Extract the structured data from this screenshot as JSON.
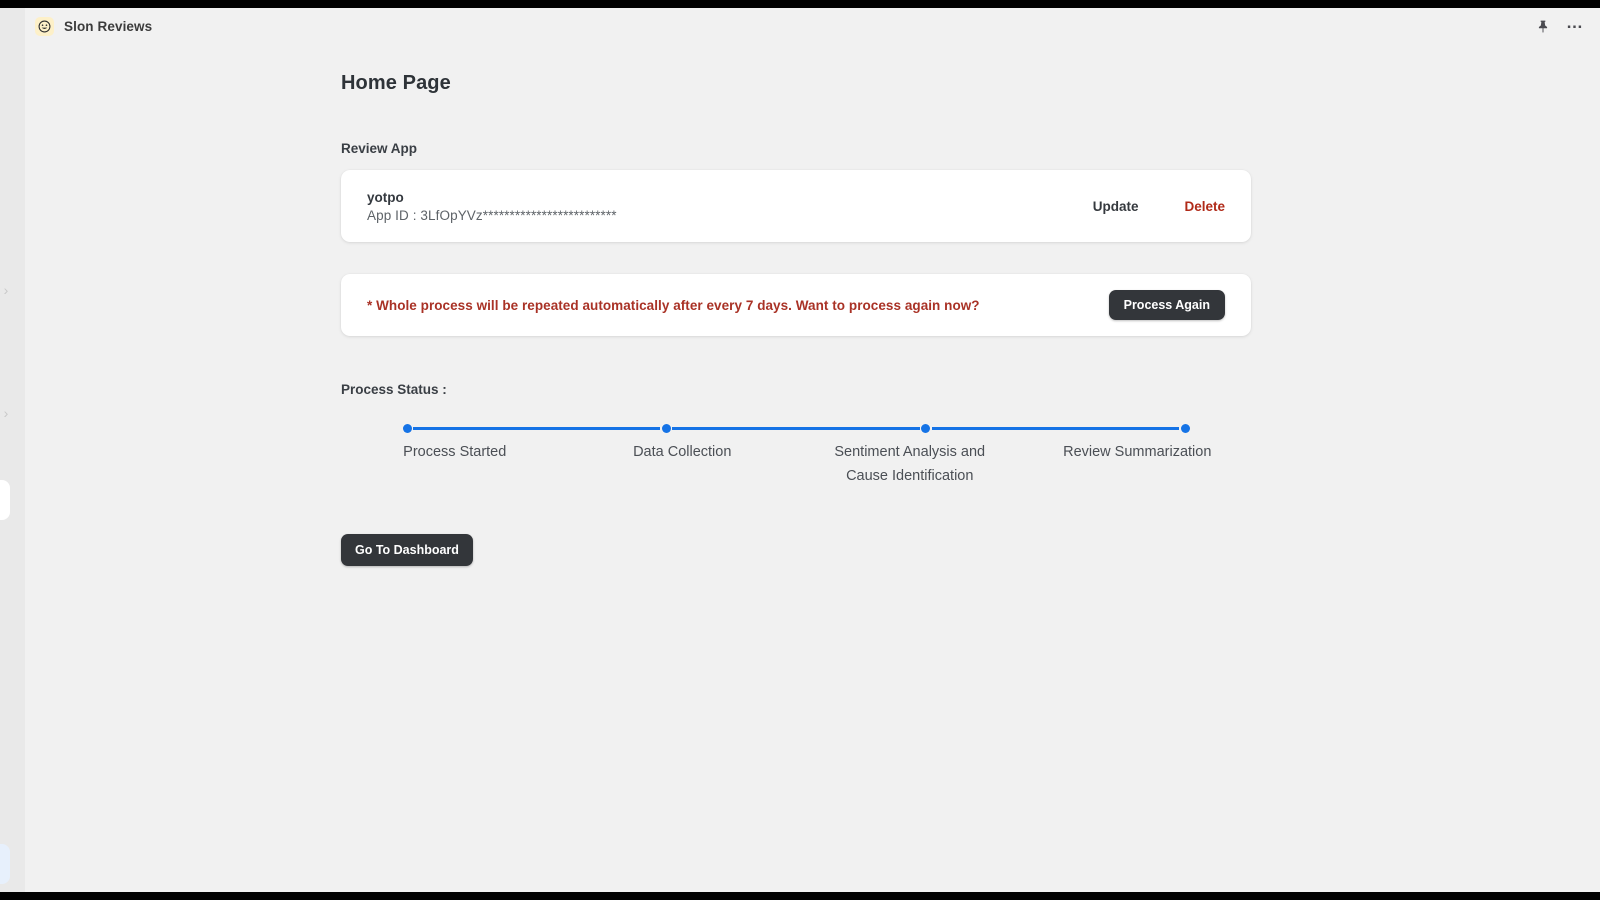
{
  "window": {
    "brand_title": "Slon Reviews",
    "brand_icon": "smiley-face-icon",
    "pin_icon": "pin-icon",
    "more_icon": "…"
  },
  "rail": {
    "chevron_icon": "›"
  },
  "page": {
    "title": "Home Page"
  },
  "review_app": {
    "section_label": "Review App",
    "app_name": "yotpo",
    "app_id": "App ID : 3LfOpYVz*************************",
    "update_label": "Update",
    "delete_label": "Delete",
    "delete_color": "#b02a18"
  },
  "notice": {
    "message": "* Whole process will be repeated automatically after every 7 days. Want to process again now?",
    "message_color": "#a93226",
    "process_again_label": "Process Again"
  },
  "process_status": {
    "section_label": "Process Status :",
    "accent_color": "#1573e6",
    "steps": [
      {
        "label": "Process Started",
        "complete": true
      },
      {
        "label": "Data Collection",
        "complete": true
      },
      {
        "label": "Sentiment Analysis and Cause Identification",
        "complete": true
      },
      {
        "label": "Review Summarization",
        "complete": true
      }
    ]
  },
  "footer": {
    "go_dashboard_label": "Go To Dashboard"
  }
}
